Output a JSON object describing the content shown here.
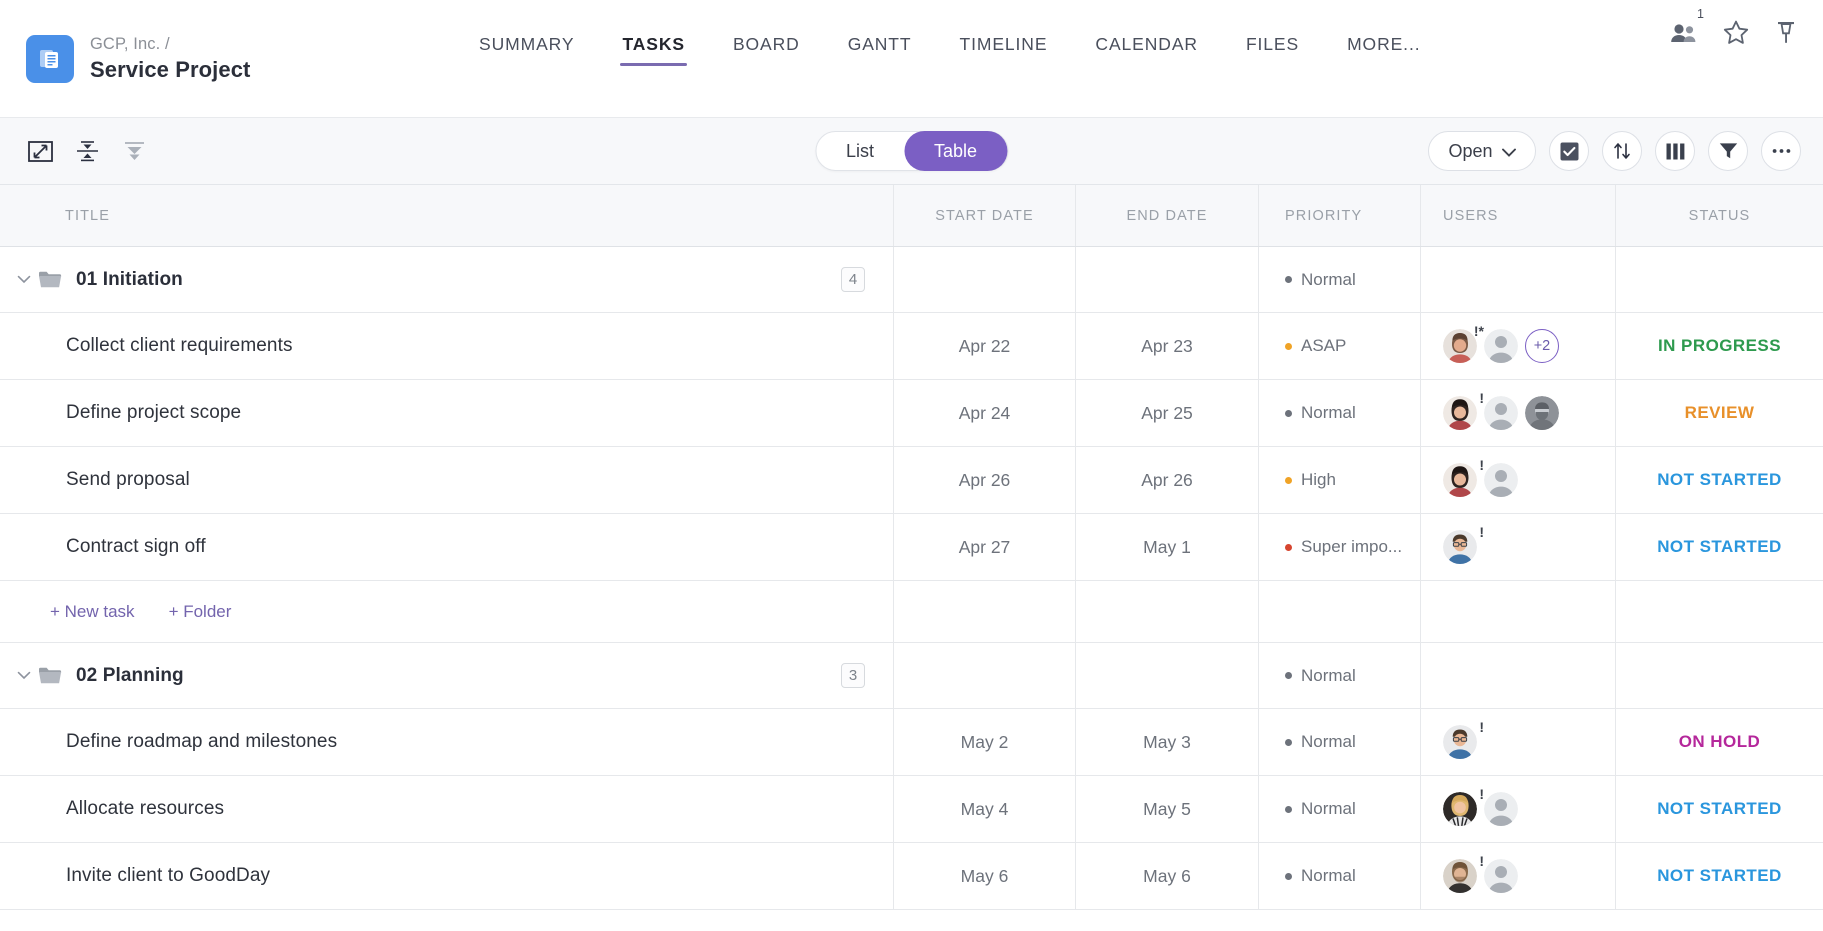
{
  "header": {
    "breadcrumb": "GCP, Inc.  /",
    "project_title": "Service Project",
    "logo_icon": "document-stack-icon",
    "logo_color": "#4a90e8",
    "tabs": [
      {
        "label": "SUMMARY",
        "active": false
      },
      {
        "label": "TASKS",
        "active": true
      },
      {
        "label": "BOARD",
        "active": false
      },
      {
        "label": "GANTT",
        "active": false
      },
      {
        "label": "TIMELINE",
        "active": false
      },
      {
        "label": "CALENDAR",
        "active": false
      },
      {
        "label": "FILES",
        "active": false
      },
      {
        "label": "MORE...",
        "active": false
      }
    ],
    "active_tab_underline_color": "#7a6bb0",
    "icons": [
      {
        "name": "people-icon",
        "badge": "1"
      },
      {
        "name": "star-icon",
        "badge": ""
      },
      {
        "name": "pin-icon",
        "badge": ""
      }
    ]
  },
  "toolbar": {
    "left_icons": [
      {
        "name": "fullscreen-icon"
      },
      {
        "name": "collapse-all-icon"
      },
      {
        "name": "expand-all-icon"
      }
    ],
    "view_toggle": {
      "options": [
        "List",
        "Table"
      ],
      "selected": "Table",
      "selected_color": "#7b5fc4"
    },
    "status_filter": {
      "label": "Open",
      "chevron": "chevron-down-icon"
    },
    "right_icons": [
      {
        "name": "checkbox-icon"
      },
      {
        "name": "sort-icon"
      },
      {
        "name": "columns-icon"
      },
      {
        "name": "filter-icon"
      },
      {
        "name": "more-options-icon"
      }
    ]
  },
  "table": {
    "columns": [
      "TITLE",
      "START DATE",
      "END DATE",
      "PRIORITY",
      "USERS",
      "STATUS"
    ],
    "groups": [
      {
        "name": "01 Initiation",
        "count": "4",
        "expanded": true,
        "priority": {
          "label": "Normal",
          "color": "#6d727b"
        },
        "start_date": "",
        "end_date": "",
        "status": "",
        "tasks": [
          {
            "title": "Collect client requirements",
            "start_date": "Apr 22",
            "end_date": "Apr 23",
            "priority": {
              "label": "ASAP",
              "color": "#f0a326"
            },
            "users": [
              {
                "avatar": "avatar-woman-dark-hair",
                "mark": "!*"
              },
              {
                "avatar": "avatar-grey-placeholder",
                "mark": ""
              }
            ],
            "users_more": "+2",
            "status": {
              "label": "IN PROGRESS",
              "color": "#2e9a4e"
            }
          },
          {
            "title": "Define project scope",
            "start_date": "Apr 24",
            "end_date": "Apr 25",
            "priority": {
              "label": "Normal",
              "color": "#6d727b"
            },
            "users": [
              {
                "avatar": "avatar-woman-dark-hair",
                "mark": "!"
              },
              {
                "avatar": "avatar-grey-placeholder",
                "mark": ""
              },
              {
                "avatar": "avatar-man-beard",
                "mark": ""
              }
            ],
            "users_more": "",
            "status": {
              "label": "REVIEW",
              "color": "#e8902a"
            }
          },
          {
            "title": "Send proposal",
            "start_date": "Apr 26",
            "end_date": "Apr 26",
            "priority": {
              "label": "High",
              "color": "#f0a326"
            },
            "users": [
              {
                "avatar": "avatar-woman-dark-hair",
                "mark": "!"
              },
              {
                "avatar": "avatar-grey-placeholder",
                "mark": ""
              }
            ],
            "users_more": "",
            "status": {
              "label": "NOT STARTED",
              "color": "#2a96dd"
            }
          },
          {
            "title": "Contract sign off",
            "start_date": "Apr 27",
            "end_date": "May 1",
            "priority": {
              "label": "Super impo...",
              "color": "#d6452f"
            },
            "users": [
              {
                "avatar": "avatar-man-glasses",
                "mark": "!"
              }
            ],
            "users_more": "",
            "status": {
              "label": "NOT STARTED",
              "color": "#2a96dd"
            }
          }
        ],
        "add_links": [
          "+ New task",
          "+ Folder"
        ]
      },
      {
        "name": "02 Planning",
        "count": "3",
        "expanded": true,
        "priority": {
          "label": "Normal",
          "color": "#6d727b"
        },
        "start_date": "",
        "end_date": "",
        "status": "",
        "tasks": [
          {
            "title": "Define roadmap and milestones",
            "start_date": "May 2",
            "end_date": "May 3",
            "priority": {
              "label": "Normal",
              "color": "#6d727b"
            },
            "users": [
              {
                "avatar": "avatar-man-glasses",
                "mark": "!"
              }
            ],
            "users_more": "",
            "status": {
              "label": "ON HOLD",
              "color": "#b5279b"
            }
          },
          {
            "title": "Allocate resources",
            "start_date": "May 4",
            "end_date": "May 5",
            "priority": {
              "label": "Normal",
              "color": "#6d727b"
            },
            "users": [
              {
                "avatar": "avatar-woman-blonde",
                "mark": "!"
              },
              {
                "avatar": "avatar-grey-placeholder",
                "mark": ""
              }
            ],
            "users_more": "",
            "status": {
              "label": "NOT STARTED",
              "color": "#2a96dd"
            }
          },
          {
            "title": "Invite client to GoodDay",
            "start_date": "May 6",
            "end_date": "May 6",
            "priority": {
              "label": "Normal",
              "color": "#6d727b"
            },
            "users": [
              {
                "avatar": "avatar-man-brown-hair",
                "mark": "!"
              },
              {
                "avatar": "avatar-grey-placeholder",
                "mark": ""
              }
            ],
            "users_more": "",
            "status": {
              "label": "NOT STARTED",
              "color": "#2a96dd"
            }
          }
        ],
        "add_links": []
      }
    ]
  }
}
